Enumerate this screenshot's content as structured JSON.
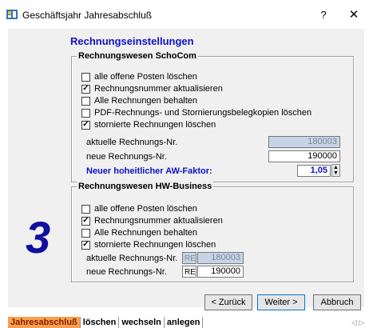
{
  "window": {
    "title": "Geschäftsjahr Jahresabschluß",
    "help": "?",
    "close": "✕"
  },
  "heading": "Rechnungseinstellungen",
  "group1": {
    "legend": "Rechnungswesen SchoCom",
    "checkboxes": [
      {
        "label": "alle offene Posten löschen",
        "checked": false
      },
      {
        "label": "Rechnungsnummer aktualisieren",
        "checked": true
      },
      {
        "label": "Alle Rechnungen behalten",
        "checked": false
      },
      {
        "label": "PDF-Rechnungs- und Stornierungsbelegkopien löschen",
        "checked": false
      },
      {
        "label": "stornierte Rechnungen löschen",
        "checked": true
      }
    ],
    "current_label": "aktuelle Rechnungs-Nr.",
    "current_value": "180003",
    "new_label": "neue Rechnungs-Nr.",
    "new_value": "190000",
    "factor_label": "Neuer hoheitlicher AW-Faktor:",
    "factor_value": "1,05"
  },
  "group2": {
    "legend": "Rechnungswesen HW-Business",
    "checkboxes": [
      {
        "label": "alle offene Posten löschen",
        "checked": false
      },
      {
        "label": "Rechnungsnummer aktualisieren",
        "checked": true
      },
      {
        "label": "Alle Rechnungen behalten",
        "checked": false
      },
      {
        "label": "stornierte Rechnungen löschen",
        "checked": true
      }
    ],
    "current_label": "aktuelle Rechnungs-Nr.",
    "current_prefix": "RE",
    "current_value": "180003",
    "new_label": "neue Rechnungs-Nr.",
    "new_prefix": "RE",
    "new_value": "190000"
  },
  "step_number": "3",
  "buttons": {
    "back": "< Zurück",
    "next": "Weiter >",
    "cancel": "Abbruch"
  },
  "tabs": [
    "Jahresabschluß",
    "löschen",
    "wechseln",
    "anlegen"
  ],
  "tab_nav": "◁ ▷"
}
